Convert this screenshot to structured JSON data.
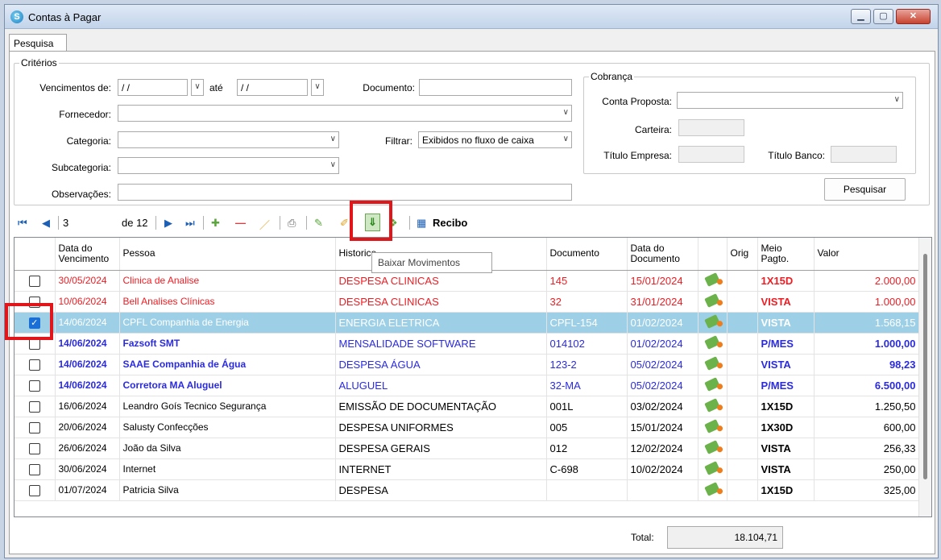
{
  "window": {
    "title": "Contas à Pagar",
    "app_icon_glyph": "S"
  },
  "tabs": [
    {
      "label": "Pesquisa"
    }
  ],
  "criteria": {
    "legend": "Critérios",
    "venc_label": "Vencimentos de:",
    "venc_from": "/ /",
    "ate_label": "até",
    "venc_to": "/ /",
    "documento_label": "Documento:",
    "documento_value": "",
    "fornecedor_label": "Fornecedor:",
    "categoria_label": "Categoria:",
    "filtrar_label": "Filtrar:",
    "filtrar_value": "Exibidos no fluxo de caixa",
    "subcategoria_label": "Subcategoria:",
    "observacoes_label": "Observações:"
  },
  "cobranca": {
    "legend": "Cobrança",
    "conta_label": "Conta Proposta:",
    "carteira_label": "Carteira:",
    "titulo_empresa_label": "Título Empresa:",
    "titulo_banco_label": "Título Banco:"
  },
  "search_button": "Pesquisar",
  "navigator": {
    "current": "3",
    "of_label": "de 12",
    "recibo_label": "Recibo"
  },
  "tooltip": "Baixar Movimentos",
  "columns": [
    "",
    "Data do Vencimento",
    "Pessoa",
    "Historico",
    "Documento",
    "Data do Documento",
    "",
    "Orig",
    "Meio Pagto.",
    "Valor"
  ],
  "rows": [
    {
      "checked": false,
      "venc": "30/05/2024",
      "pessoa": "Clinica de Analise",
      "historico": "DESPESA CLINICAS",
      "documento": "145",
      "data_doc": "15/01/2024",
      "orig": "",
      "meio": "1X15D",
      "valor": "2.000,00",
      "style": "red"
    },
    {
      "checked": false,
      "venc": "10/06/2024",
      "pessoa": "Bell Analises Clínicas",
      "historico": "DESPESA CLINICAS",
      "documento": "32",
      "data_doc": "31/01/2024",
      "orig": "",
      "meio": "VISTA",
      "valor": "1.000,00",
      "style": "red"
    },
    {
      "checked": true,
      "venc": "14/06/2024",
      "pessoa": "CPFL Companhia de Energia",
      "historico": "ENERGIA ELETRICA",
      "documento": "CPFL-154",
      "data_doc": "01/02/2024",
      "orig": "",
      "meio": "VISTA",
      "valor": "1.568,15",
      "style": "sel"
    },
    {
      "checked": false,
      "venc": "14/06/2024",
      "pessoa": "Fazsoft SMT",
      "historico": "MENSALIDADE SOFTWARE",
      "documento": "014102",
      "data_doc": "01/02/2024",
      "orig": "",
      "meio": "P/MES",
      "valor": "1.000,00",
      "style": "blue"
    },
    {
      "checked": false,
      "venc": "14/06/2024",
      "pessoa": "SAAE Companhia de Água",
      "historico": "DESPESA ÁGUA",
      "documento": "123-2",
      "data_doc": "05/02/2024",
      "orig": "",
      "meio": "VISTA",
      "valor": "98,23",
      "style": "blue"
    },
    {
      "checked": false,
      "venc": "14/06/2024",
      "pessoa": "Corretora MA Aluguel",
      "historico": "ALUGUEL",
      "documento": "32-MA",
      "data_doc": "05/02/2024",
      "orig": "",
      "meio": "P/MES",
      "valor": "6.500,00",
      "style": "blue"
    },
    {
      "checked": false,
      "venc": "16/06/2024",
      "pessoa": "Leandro Goís Tecnico Segurança",
      "historico": "EMISSÃO DE DOCUMENTAÇÃO",
      "documento": "001L",
      "data_doc": "03/02/2024",
      "orig": "",
      "meio": "1X15D",
      "valor": "1.250,50",
      "style": "black"
    },
    {
      "checked": false,
      "venc": "20/06/2024",
      "pessoa": "Salusty Confecções",
      "historico": "DESPESA UNIFORMES",
      "documento": "005",
      "data_doc": "15/01/2024",
      "orig": "",
      "meio": "1X30D",
      "valor": "600,00",
      "style": "black"
    },
    {
      "checked": false,
      "venc": "26/06/2024",
      "pessoa": "João da Silva",
      "historico": "DESPESA GERAIS",
      "documento": "012",
      "data_doc": "12/02/2024",
      "orig": "",
      "meio": "VISTA",
      "valor": "256,33",
      "style": "black"
    },
    {
      "checked": false,
      "venc": "30/06/2024",
      "pessoa": "Internet",
      "historico": "INTERNET",
      "documento": "C-698",
      "data_doc": "10/02/2024",
      "orig": "",
      "meio": "VISTA",
      "valor": "250,00",
      "style": "black"
    },
    {
      "checked": false,
      "venc": "01/07/2024",
      "pessoa": "Patricia Silva",
      "historico": "DESPESA",
      "documento": "",
      "data_doc": "",
      "orig": "",
      "meio": "1X15D",
      "valor": "325,00",
      "style": "black"
    }
  ],
  "total": {
    "label": "Total:",
    "value": "18.104,71"
  },
  "colors": {
    "overdue": "#ee1d23",
    "scheduled": "#2a2ae0",
    "selected_row": "#9dd0e6",
    "highlight_box": "#e0161a"
  }
}
